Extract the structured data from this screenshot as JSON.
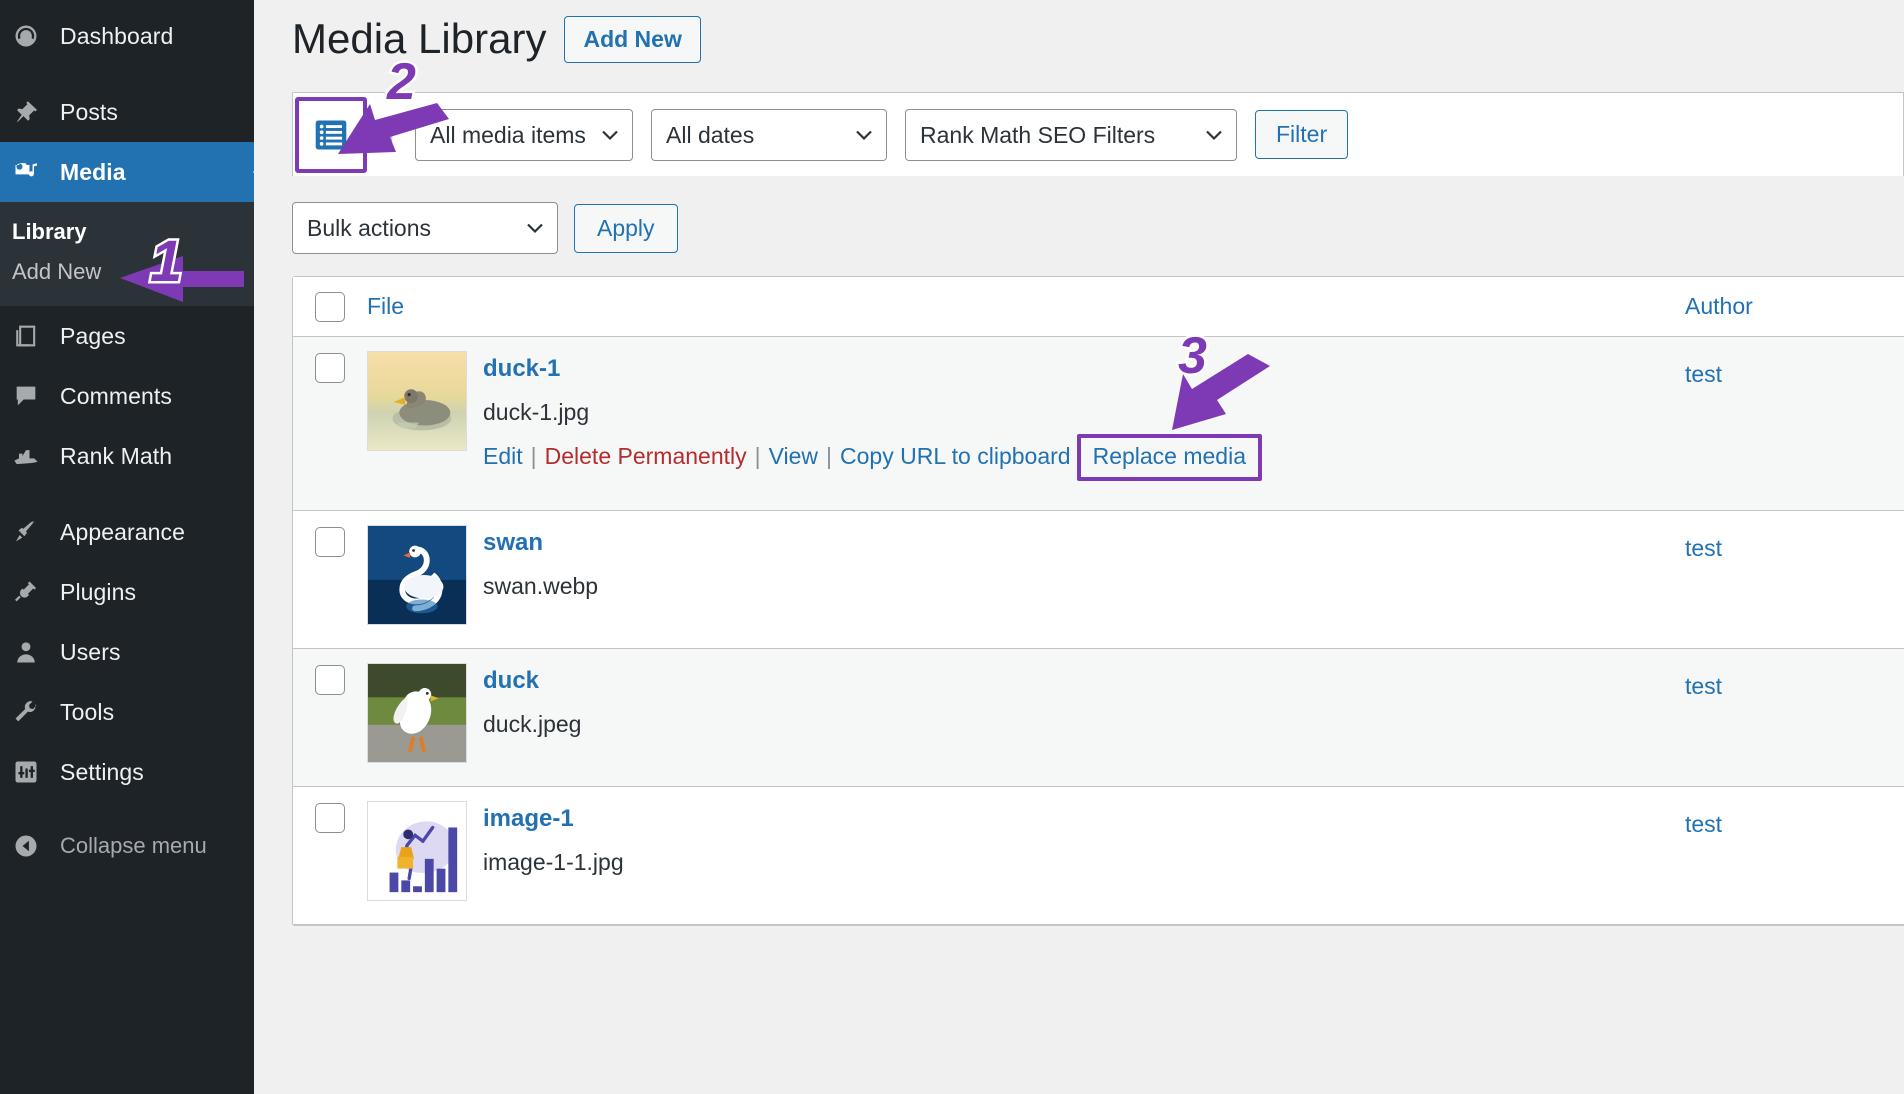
{
  "sidebar": {
    "items": [
      {
        "label": "Dashboard",
        "icon": "dashboard-icon",
        "current": false
      },
      {
        "label": "Posts",
        "icon": "pin-icon",
        "current": false
      },
      {
        "label": "Media",
        "icon": "media-icon",
        "current": true
      },
      {
        "label": "Pages",
        "icon": "pages-icon",
        "current": false
      },
      {
        "label": "Comments",
        "icon": "comments-icon",
        "current": false
      },
      {
        "label": "Rank Math",
        "icon": "rank-math-icon",
        "current": false
      },
      {
        "label": "Appearance",
        "icon": "brush-icon",
        "current": false
      },
      {
        "label": "Plugins",
        "icon": "plug-icon",
        "current": false
      },
      {
        "label": "Users",
        "icon": "user-icon",
        "current": false
      },
      {
        "label": "Tools",
        "icon": "wrench-icon",
        "current": false
      },
      {
        "label": "Settings",
        "icon": "settings-icon",
        "current": false
      }
    ],
    "media_submenu": [
      {
        "label": "Library",
        "current": true
      },
      {
        "label": "Add New",
        "current": false
      }
    ],
    "collapse": {
      "label": "Collapse menu",
      "icon": "collapse-arrow-icon"
    }
  },
  "header": {
    "title": "Media Library",
    "add_new_label": "Add New"
  },
  "toolbar": {
    "view_list_icon": "list-view-icon",
    "view_grid_icon": "grid-view-icon",
    "media_items_filter": "All media items",
    "dates_filter": "All dates",
    "seo_filter": "Rank Math SEO Filters",
    "filter_button": "Filter"
  },
  "bulk": {
    "select_value": "Bulk actions",
    "apply_label": "Apply"
  },
  "table": {
    "columns": {
      "file": "File",
      "author": "Author"
    },
    "rows": [
      {
        "title": "duck-1",
        "filename": "duck-1.jpg",
        "author": "test",
        "thumb": "duck-1-thumb",
        "actions": {
          "edit": "Edit",
          "delete": "Delete Permanently",
          "view": "View",
          "copy_url": "Copy URL to clipboard",
          "replace": "Replace media"
        }
      },
      {
        "title": "swan",
        "filename": "swan.webp",
        "author": "test",
        "thumb": "swan-thumb",
        "actions": null
      },
      {
        "title": "duck",
        "filename": "duck.jpeg",
        "author": "test",
        "thumb": "duck-thumb",
        "actions": null
      },
      {
        "title": "image-1",
        "filename": "image-1-1.jpg",
        "author": "test",
        "thumb": "image-1-thumb",
        "actions": null
      }
    ]
  },
  "annotations": {
    "accent_color": "#7e3ab5",
    "markers": [
      {
        "number": "1",
        "target": "sidebar-item-library"
      },
      {
        "number": "2",
        "target": "list-view-toggle"
      },
      {
        "number": "3",
        "target": "replace-media-link"
      }
    ]
  },
  "colors": {
    "sidebar_bg": "#1d2327",
    "submenu_bg": "#2c3338",
    "current_menu": "#2271b1",
    "link": "#2271b1",
    "danger": "#b32d2e",
    "page_bg": "#f0f0f1"
  }
}
